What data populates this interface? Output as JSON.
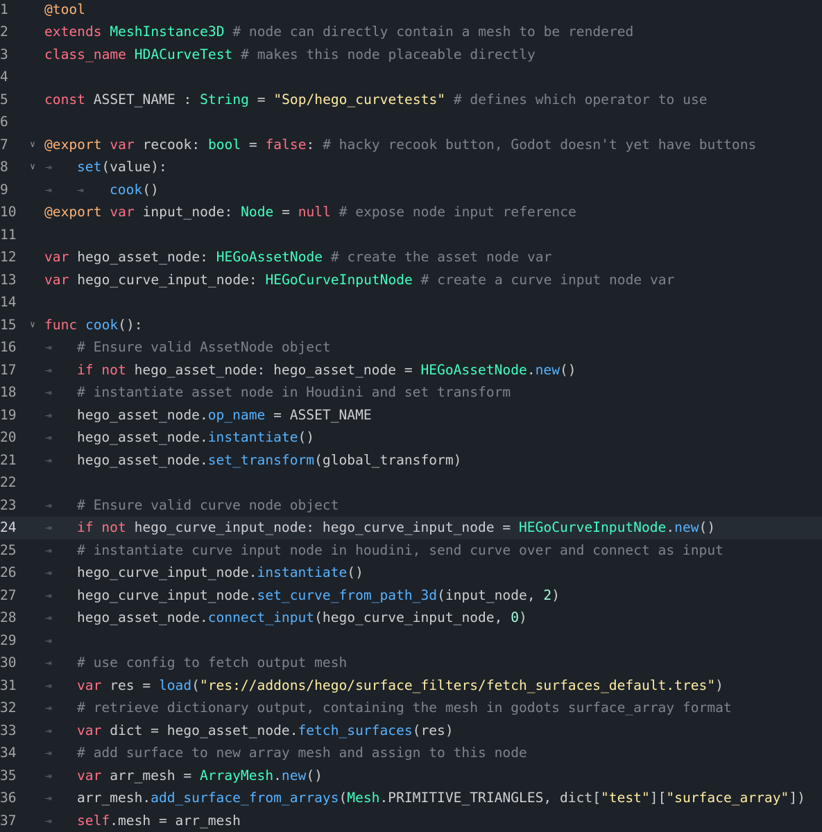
{
  "editor": {
    "lines": [
      {
        "n": "1",
        "tabs": 0,
        "tokens": [
          [
            "an",
            "@tool"
          ]
        ]
      },
      {
        "n": "2",
        "tabs": 0,
        "tokens": [
          [
            "kw",
            "extends "
          ],
          [
            "ty",
            "MeshInstance3D"
          ],
          [
            "cm",
            " # node can directly contain a mesh to be rendered"
          ]
        ]
      },
      {
        "n": "3",
        "tabs": 0,
        "tokens": [
          [
            "kw",
            "class_name "
          ],
          [
            "ty",
            "HDACurveTest"
          ],
          [
            "cm",
            " # makes this node placeable directly"
          ]
        ]
      },
      {
        "n": "4",
        "tabs": 0,
        "tokens": []
      },
      {
        "n": "5",
        "tabs": 0,
        "tokens": [
          [
            "kw",
            "const "
          ],
          [
            "tx",
            "ASSET_NAME : "
          ],
          [
            "ty",
            "String"
          ],
          [
            "tx",
            " = "
          ],
          [
            "str",
            "\"Sop/hego_curvetests\""
          ],
          [
            "cm",
            " # defines which operator to use"
          ]
        ]
      },
      {
        "n": "6",
        "tabs": 0,
        "tokens": []
      },
      {
        "n": "7",
        "tabs": 0,
        "fold": true,
        "tokens": [
          [
            "an",
            "@export"
          ],
          [
            "kw",
            " var "
          ],
          [
            "tx",
            "recook: "
          ],
          [
            "ty",
            "bool"
          ],
          [
            "tx",
            " = "
          ],
          [
            "kw",
            "false"
          ],
          [
            "tx",
            ": "
          ],
          [
            "cm",
            "# hacky recook button, Godot doesn't yet have buttons"
          ]
        ]
      },
      {
        "n": "8",
        "tabs": 1,
        "fold": true,
        "tokens": [
          [
            "fn",
            "set"
          ],
          [
            "tx",
            "(value):"
          ]
        ]
      },
      {
        "n": "9",
        "tabs": 2,
        "tokens": [
          [
            "fn",
            "cook"
          ],
          [
            "tx",
            "()"
          ]
        ]
      },
      {
        "n": "10",
        "tabs": 0,
        "tokens": [
          [
            "an",
            "@export"
          ],
          [
            "kw",
            " var "
          ],
          [
            "tx",
            "input_node: "
          ],
          [
            "ty",
            "Node"
          ],
          [
            "tx",
            " = "
          ],
          [
            "kw",
            "null"
          ],
          [
            "cm",
            " # expose node input reference"
          ]
        ]
      },
      {
        "n": "11",
        "tabs": 0,
        "tokens": []
      },
      {
        "n": "12",
        "tabs": 0,
        "tokens": [
          [
            "kw",
            "var "
          ],
          [
            "tx",
            "hego_asset_node: "
          ],
          [
            "ty",
            "HEGoAssetNode"
          ],
          [
            "cm",
            " # create the asset node var"
          ]
        ]
      },
      {
        "n": "13",
        "tabs": 0,
        "tokens": [
          [
            "kw",
            "var "
          ],
          [
            "tx",
            "hego_curve_input_node: "
          ],
          [
            "ty",
            "HEGoCurveInputNode"
          ],
          [
            "cm",
            " # create a curve input node var"
          ]
        ]
      },
      {
        "n": "14",
        "tabs": 0,
        "tokens": []
      },
      {
        "n": "15",
        "tabs": 0,
        "fold": true,
        "tokens": [
          [
            "kw",
            "func "
          ],
          [
            "fn",
            "cook"
          ],
          [
            "tx",
            "():"
          ]
        ]
      },
      {
        "n": "16",
        "tabs": 1,
        "tokens": [
          [
            "cm",
            "# Ensure valid AssetNode object"
          ]
        ]
      },
      {
        "n": "17",
        "tabs": 1,
        "tokens": [
          [
            "kw",
            "if not "
          ],
          [
            "tx",
            "hego_asset_node: hego_asset_node = "
          ],
          [
            "ty",
            "HEGoAssetNode"
          ],
          [
            "tx",
            "."
          ],
          [
            "fn",
            "new"
          ],
          [
            "tx",
            "()"
          ]
        ]
      },
      {
        "n": "18",
        "tabs": 1,
        "tokens": [
          [
            "cm",
            "# instantiate asset node in Houdini and set transform"
          ]
        ]
      },
      {
        "n": "19",
        "tabs": 1,
        "tokens": [
          [
            "tx",
            "hego_asset_node."
          ],
          [
            "fn",
            "op_name"
          ],
          [
            "tx",
            " = ASSET_NAME"
          ]
        ]
      },
      {
        "n": "20",
        "tabs": 1,
        "tokens": [
          [
            "tx",
            "hego_asset_node."
          ],
          [
            "fn",
            "instantiate"
          ],
          [
            "tx",
            "()"
          ]
        ]
      },
      {
        "n": "21",
        "tabs": 1,
        "tokens": [
          [
            "tx",
            "hego_asset_node."
          ],
          [
            "fn",
            "set_transform"
          ],
          [
            "tx",
            "(global_transform)"
          ]
        ]
      },
      {
        "n": "22",
        "tabs": 0,
        "tokens": []
      },
      {
        "n": "23",
        "tabs": 1,
        "tokens": [
          [
            "cm",
            "# Ensure valid curve node object"
          ]
        ]
      },
      {
        "n": "24",
        "tabs": 1,
        "current": true,
        "tokens": [
          [
            "kw",
            "if not "
          ],
          [
            "tx",
            "hego_curve_input_node: hego_curve_input_node = "
          ],
          [
            "ty",
            "HEGoCurveInputNode"
          ],
          [
            "tx",
            "."
          ],
          [
            "fn",
            "new"
          ],
          [
            "tx",
            "()"
          ]
        ]
      },
      {
        "n": "25",
        "tabs": 1,
        "tokens": [
          [
            "cm",
            "# instantiate curve input node in houdini, send curve over and connect as input"
          ]
        ]
      },
      {
        "n": "26",
        "tabs": 1,
        "tokens": [
          [
            "tx",
            "hego_curve_input_node."
          ],
          [
            "fn",
            "instantiate"
          ],
          [
            "tx",
            "()"
          ]
        ]
      },
      {
        "n": "27",
        "tabs": 1,
        "tokens": [
          [
            "tx",
            "hego_curve_input_node."
          ],
          [
            "fn",
            "set_curve_from_path_3d"
          ],
          [
            "tx",
            "(input_node, "
          ],
          [
            "num",
            "2"
          ],
          [
            "tx",
            ")"
          ]
        ]
      },
      {
        "n": "28",
        "tabs": 1,
        "tokens": [
          [
            "tx",
            "hego_asset_node."
          ],
          [
            "fn",
            "connect_input"
          ],
          [
            "tx",
            "(hego_curve_input_node, "
          ],
          [
            "num",
            "0"
          ],
          [
            "tx",
            ")"
          ]
        ]
      },
      {
        "n": "29",
        "tabs": 1,
        "tokens": []
      },
      {
        "n": "30",
        "tabs": 1,
        "tokens": [
          [
            "cm",
            "# use config to fetch output mesh"
          ]
        ]
      },
      {
        "n": "31",
        "tabs": 1,
        "tokens": [
          [
            "kw",
            "var "
          ],
          [
            "tx",
            "res = "
          ],
          [
            "fn",
            "load"
          ],
          [
            "tx",
            "("
          ],
          [
            "str",
            "\"res://addons/hego/surface_filters/fetch_surfaces_default.tres\""
          ],
          [
            "tx",
            ")"
          ]
        ]
      },
      {
        "n": "32",
        "tabs": 1,
        "tokens": [
          [
            "cm",
            "# retrieve dictionary output, containing the mesh in godots surface_array format"
          ]
        ]
      },
      {
        "n": "33",
        "tabs": 1,
        "tokens": [
          [
            "kw",
            "var "
          ],
          [
            "tx",
            "dict = hego_asset_node."
          ],
          [
            "fn",
            "fetch_surfaces"
          ],
          [
            "tx",
            "(res)"
          ]
        ]
      },
      {
        "n": "34",
        "tabs": 1,
        "tokens": [
          [
            "cm",
            "# add surface to new array mesh and assign to this node"
          ]
        ]
      },
      {
        "n": "35",
        "tabs": 1,
        "tokens": [
          [
            "kw",
            "var "
          ],
          [
            "tx",
            "arr_mesh = "
          ],
          [
            "ty",
            "ArrayMesh"
          ],
          [
            "tx",
            "."
          ],
          [
            "fn",
            "new"
          ],
          [
            "tx",
            "()"
          ]
        ]
      },
      {
        "n": "36",
        "tabs": 1,
        "tokens": [
          [
            "tx",
            "arr_mesh."
          ],
          [
            "fn",
            "add_surface_from_arrays"
          ],
          [
            "tx",
            "("
          ],
          [
            "ty",
            "Mesh"
          ],
          [
            "tx",
            ".PRIMITIVE_TRIANGLES, dict["
          ],
          [
            "str",
            "\"test\""
          ],
          [
            "tx",
            "]["
          ],
          [
            "str",
            "\"surface_array\""
          ],
          [
            "tx",
            "])"
          ]
        ]
      },
      {
        "n": "37",
        "tabs": 1,
        "tokens": [
          [
            "kw",
            "self"
          ],
          [
            "tx",
            ".mesh = arr_mesh"
          ]
        ]
      }
    ]
  },
  "icons": {
    "fold": "chevron-down-icon",
    "tab": "tab-indent-icon"
  },
  "colors": {
    "background": "#1d2229",
    "current_line": "#262c34",
    "keyword": "#ff7085",
    "type": "#42ffc2",
    "function": "#57b3ff",
    "string": "#ffeda1",
    "comment": "#7e848c",
    "annotation": "#ffb373",
    "number": "#a1ffe0",
    "text": "#cdcfd2"
  }
}
